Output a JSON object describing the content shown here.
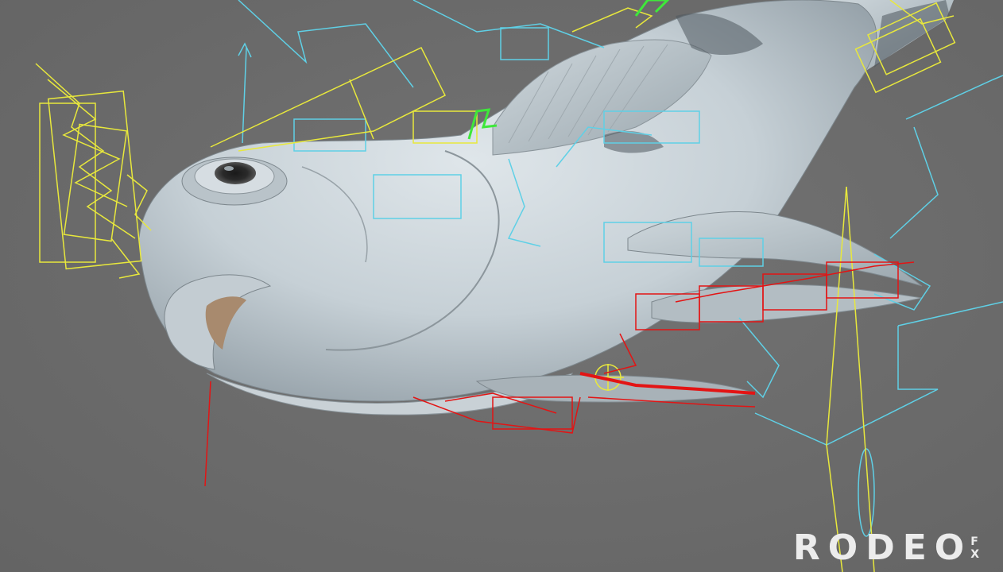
{
  "viewport": {
    "background": "#6b6b6b",
    "subject": "fish-model"
  },
  "rig_colors": {
    "cyan": "#5fd0e6",
    "yellow": "#e8e83c",
    "red": "#e31414",
    "green": "#3ee83a"
  },
  "watermark": {
    "main": "RODEO",
    "sub_top": "F",
    "sub_bottom": "X"
  }
}
